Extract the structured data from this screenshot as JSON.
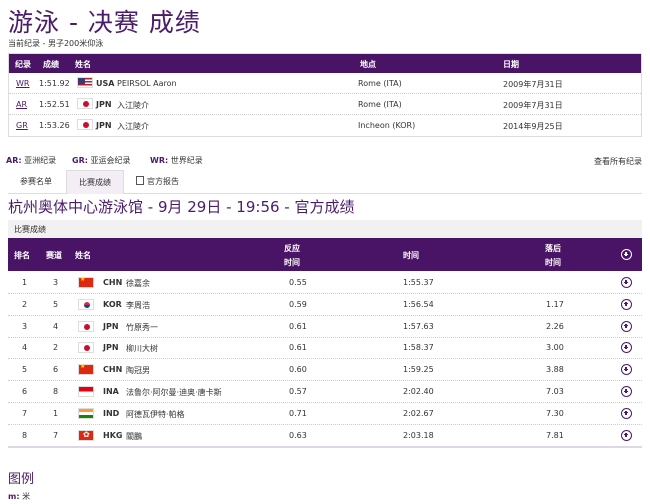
{
  "page": {
    "title": "游泳 - 决赛 成绩",
    "subtitle": "当前纪录 - 男子200米仰泳"
  },
  "records": {
    "headers": [
      "纪录",
      "成绩",
      "姓名",
      "地点",
      "日期"
    ],
    "rows": [
      {
        "code": "WR",
        "time": "1:51.92",
        "flag": "usa",
        "noc": "USA",
        "name": "PEIRSOL Aaron",
        "place": "Rome (ITA)",
        "date": "2009年7月31日"
      },
      {
        "code": "AR",
        "time": "1:52.51",
        "flag": "jpn",
        "noc": "JPN",
        "name": "入江陵介",
        "place": "Rome (ITA)",
        "date": "2009年7月31日"
      },
      {
        "code": "GR",
        "time": "1:53.26",
        "flag": "jpn",
        "noc": "JPN",
        "name": "入江陵介",
        "place": "Incheon (KOR)",
        "date": "2014年9月25日"
      }
    ]
  },
  "record_legend": {
    "ar_code": "AR:",
    "ar_text": "亚洲纪录",
    "gr_code": "GR:",
    "gr_text": "亚运会纪录",
    "wr_code": "WR:",
    "wr_text": "世界纪录",
    "view_all": "查看所有纪录"
  },
  "tabs": {
    "entry_list": "参赛名单",
    "results": "比赛成绩",
    "official_report": "官方报告",
    "official_report_icon": "document-icon"
  },
  "venue_line": "杭州奥体中心游泳馆 - 9月 29日 - 19:56 - 官方成绩",
  "results_label": "比赛成绩",
  "results": {
    "headers": {
      "rank": "排名",
      "lane": "赛道",
      "name": "姓名",
      "reaction_1": "反应",
      "reaction_2": "时间",
      "time": "时间",
      "behind_1": "落后",
      "behind_2": "时间"
    },
    "rows": [
      {
        "rank": "1",
        "lane": "3",
        "flag": "chn",
        "noc": "CHN",
        "name": "徐嘉余",
        "reaction": "0.55",
        "time": "1:55.37",
        "behind": ""
      },
      {
        "rank": "2",
        "lane": "5",
        "flag": "kor",
        "noc": "KOR",
        "name": "李周浩",
        "reaction": "0.59",
        "time": "1:56.54",
        "behind": "1.17"
      },
      {
        "rank": "3",
        "lane": "4",
        "flag": "jpn",
        "noc": "JPN",
        "name": "竹原秀一",
        "reaction": "0.61",
        "time": "1:57.63",
        "behind": "2.26"
      },
      {
        "rank": "4",
        "lane": "2",
        "flag": "jpn",
        "noc": "JPN",
        "name": "柳川大树",
        "reaction": "0.61",
        "time": "1:58.37",
        "behind": "3.00"
      },
      {
        "rank": "5",
        "lane": "6",
        "flag": "chn",
        "noc": "CHN",
        "name": "陶冠男",
        "reaction": "0.60",
        "time": "1:59.25",
        "behind": "3.88"
      },
      {
        "rank": "6",
        "lane": "8",
        "flag": "ina",
        "noc": "INA",
        "name": "法鲁尔·阿尔曼·迪奥·唐卡斯",
        "reaction": "0.57",
        "time": "2:02.40",
        "behind": "7.03"
      },
      {
        "rank": "7",
        "lane": "1",
        "flag": "ind",
        "noc": "IND",
        "name": "阿德瓦伊特·帕格",
        "reaction": "0.71",
        "time": "2:02.67",
        "behind": "7.30"
      },
      {
        "rank": "8",
        "lane": "7",
        "flag": "hkg",
        "noc": "HKG",
        "name": "關鵬",
        "reaction": "0.63",
        "time": "2:03.18",
        "behind": "7.81"
      }
    ]
  },
  "legend": {
    "title": "图例",
    "m_code": "m:",
    "m_text": "米"
  }
}
